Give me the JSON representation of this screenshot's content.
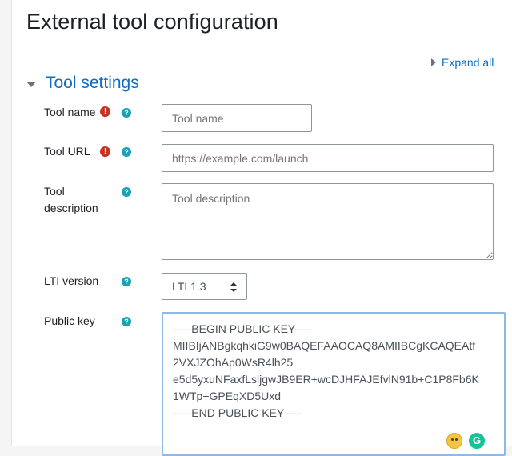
{
  "page": {
    "title": "External tool configuration",
    "expand_all": "Expand all"
  },
  "section": {
    "title": "Tool settings"
  },
  "fields": {
    "tool_name": {
      "label": "Tool name",
      "placeholder": "Tool name",
      "value": ""
    },
    "tool_url": {
      "label": "Tool URL",
      "placeholder": "https://example.com/launch",
      "value": ""
    },
    "tool_description": {
      "label_line1": "Tool",
      "label_line2": "description",
      "placeholder": "Tool description",
      "value": ""
    },
    "lti_version": {
      "label": "LTI version",
      "selected": "LTI 1.3"
    },
    "public_key": {
      "label": "Public key",
      "lines": [
        "-----BEGIN PUBLIC KEY-----",
        "MIIBIjANBgkqhkiG9w0BAQEFAAOCAQ8AMIIBCgKCAQEAtf",
        "2VXJZOhAp0WsR4lh25",
        "e5d5yxuNFaxfLsljgwJB9ER+wcDJHFAJEfvlN91b+C1P8Fb6K",
        "1WTp+GPEqXD5Uxd",
        "-----END PUBLIC KEY-----"
      ]
    }
  },
  "icons": {
    "required": "exclamation-circle-icon",
    "help": "question-circle-icon",
    "grammarly_letter": "G"
  },
  "colors": {
    "link": "#0f6cbf",
    "required": "#ca3120",
    "help": "#17a2b8"
  }
}
